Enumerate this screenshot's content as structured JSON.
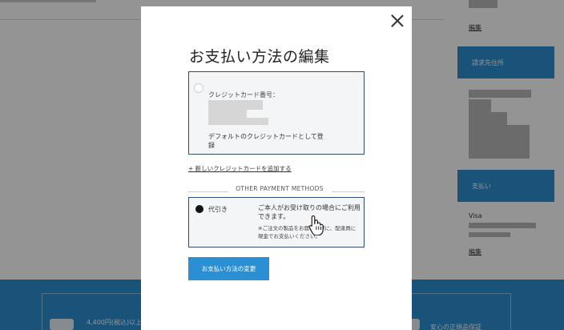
{
  "background": {
    "edit_link_1": "編集",
    "billing_panel": "請求先住所",
    "payment_panel": "支払い",
    "visa_label": "Visa",
    "edit_link_2": "編集",
    "footer_item_1": "4,400円(税込)以上",
    "footer_item_2": "安心の正規品保証"
  },
  "modal": {
    "title": "お支払い方法の編集",
    "credit_card": {
      "label": "クレジットカード番号：",
      "default_text": "デフォルトのクレジットカードとして登録"
    },
    "add_card_link": "+ 新しいクレジットカードを追加する",
    "other_methods_heading": "OTHER PAYMENT METHODS",
    "cod": {
      "label": "代引き",
      "description": "ご本人がお受け取りの場合にご利用できます。",
      "note": "※ご注文の製品をお届けの際に、配達員に現金でお支払いください。"
    },
    "change_button": "お支払い方法の変更"
  },
  "colors": {
    "accent": "#2b8fd3",
    "selected_border": "#2d4e6e",
    "overlay": "rgba(0,0,0,0.42)"
  },
  "icons": {
    "close": "close-icon",
    "cursor": "hand-pointer-icon"
  }
}
